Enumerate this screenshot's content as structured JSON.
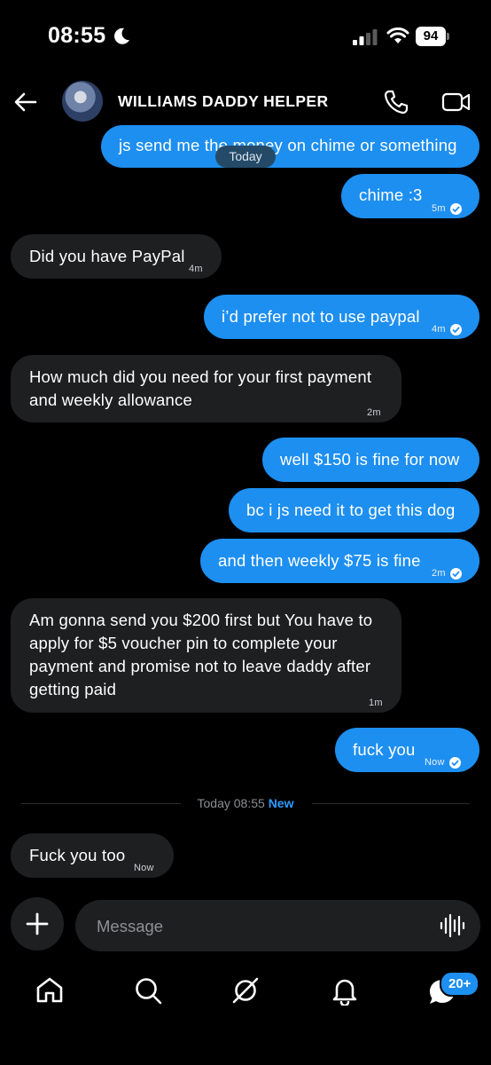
{
  "status_bar": {
    "time": "08:55",
    "battery": "94"
  },
  "header": {
    "contact_name": "WILLIAMS DADDY HELPER"
  },
  "day_pill": "Today",
  "messages": [
    {
      "dir": "out",
      "text": "js send me the money on chime or something",
      "time": ""
    },
    {
      "dir": "out",
      "text": "chime :3",
      "time": "5m"
    },
    {
      "dir": "in",
      "text": "Did you have PayPal",
      "time": "4m"
    },
    {
      "dir": "out",
      "text": "i’d prefer not to use paypal",
      "time": "4m"
    },
    {
      "dir": "in",
      "text": "How much did you need for your first payment and weekly allowance",
      "time": "2m"
    },
    {
      "dir": "out",
      "text": "well $150 is fine for now",
      "time": ""
    },
    {
      "dir": "out",
      "text": "bc i js need it to get this dog",
      "time": ""
    },
    {
      "dir": "out",
      "text": "and then weekly $75 is fine",
      "time": "2m"
    },
    {
      "dir": "in",
      "text": "Am gonna send you $200 first but You have to apply for $5 voucher pin to complete your payment and promise not to leave daddy after getting paid",
      "time": "1m"
    },
    {
      "dir": "out",
      "text": "fuck you",
      "time": "Now"
    },
    {
      "dir": "in",
      "text": "Fuck you too",
      "time": "Now"
    }
  ],
  "divider": {
    "text": "Today 08:55",
    "new_label": "New"
  },
  "composer": {
    "placeholder": "Message"
  },
  "nav": {
    "badge": "20+"
  },
  "colors": {
    "outgoing": "#1d8ff0",
    "incoming": "#1e1f21",
    "background": "#000000",
    "accent": "#2e9bff"
  }
}
